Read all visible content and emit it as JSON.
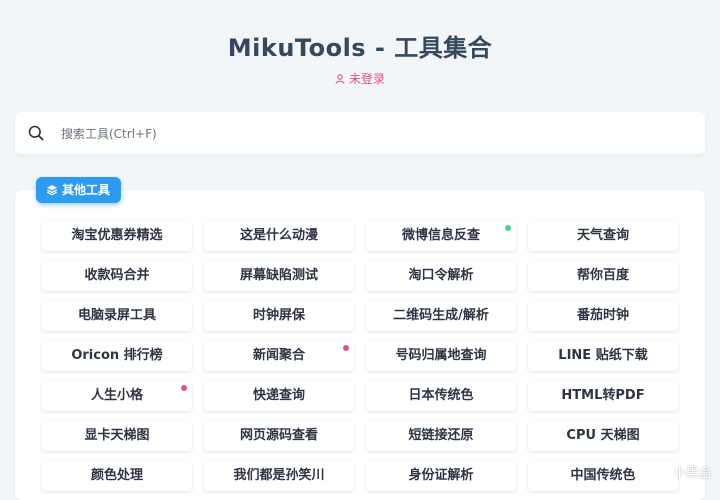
{
  "header": {
    "title": "MikuTools - 工具集合",
    "login_status": "未登录"
  },
  "search": {
    "placeholder": "搜索工具(Ctrl+F)",
    "value": ""
  },
  "section": {
    "label": "其他工具"
  },
  "colors": {
    "accent": "#2d9cf0",
    "login": "#e0557a",
    "dot_green": "#4cd08a",
    "dot_red": "#e0557a"
  },
  "tools": [
    {
      "label": "淘宝优惠券精选"
    },
    {
      "label": "这是什么动漫"
    },
    {
      "label": "微博信息反查",
      "dot": "green"
    },
    {
      "label": "天气查询"
    },
    {
      "label": "收款码合并"
    },
    {
      "label": "屏幕缺陷测试"
    },
    {
      "label": "淘口令解析"
    },
    {
      "label": "帮你百度"
    },
    {
      "label": "电脑录屏工具"
    },
    {
      "label": "时钟屏保"
    },
    {
      "label": "二维码生成/解析"
    },
    {
      "label": "番茄时钟"
    },
    {
      "label": "Oricon 排行榜"
    },
    {
      "label": "新闻聚合",
      "dot": "red"
    },
    {
      "label": "号码归属地查询"
    },
    {
      "label": "LINE 贴纸下载"
    },
    {
      "label": "人生小格",
      "dot": "red"
    },
    {
      "label": "快递查询"
    },
    {
      "label": "日本传统色"
    },
    {
      "label": "HTML转PDF"
    },
    {
      "label": "显卡天梯图"
    },
    {
      "label": "网页源码查看"
    },
    {
      "label": "短链接还原"
    },
    {
      "label": "CPU 天梯图"
    },
    {
      "label": "颜色处理"
    },
    {
      "label": "我们都是孙笑川"
    },
    {
      "label": "身份证解析"
    },
    {
      "label": "中国传统色"
    }
  ],
  "watermark": "小黑盒"
}
